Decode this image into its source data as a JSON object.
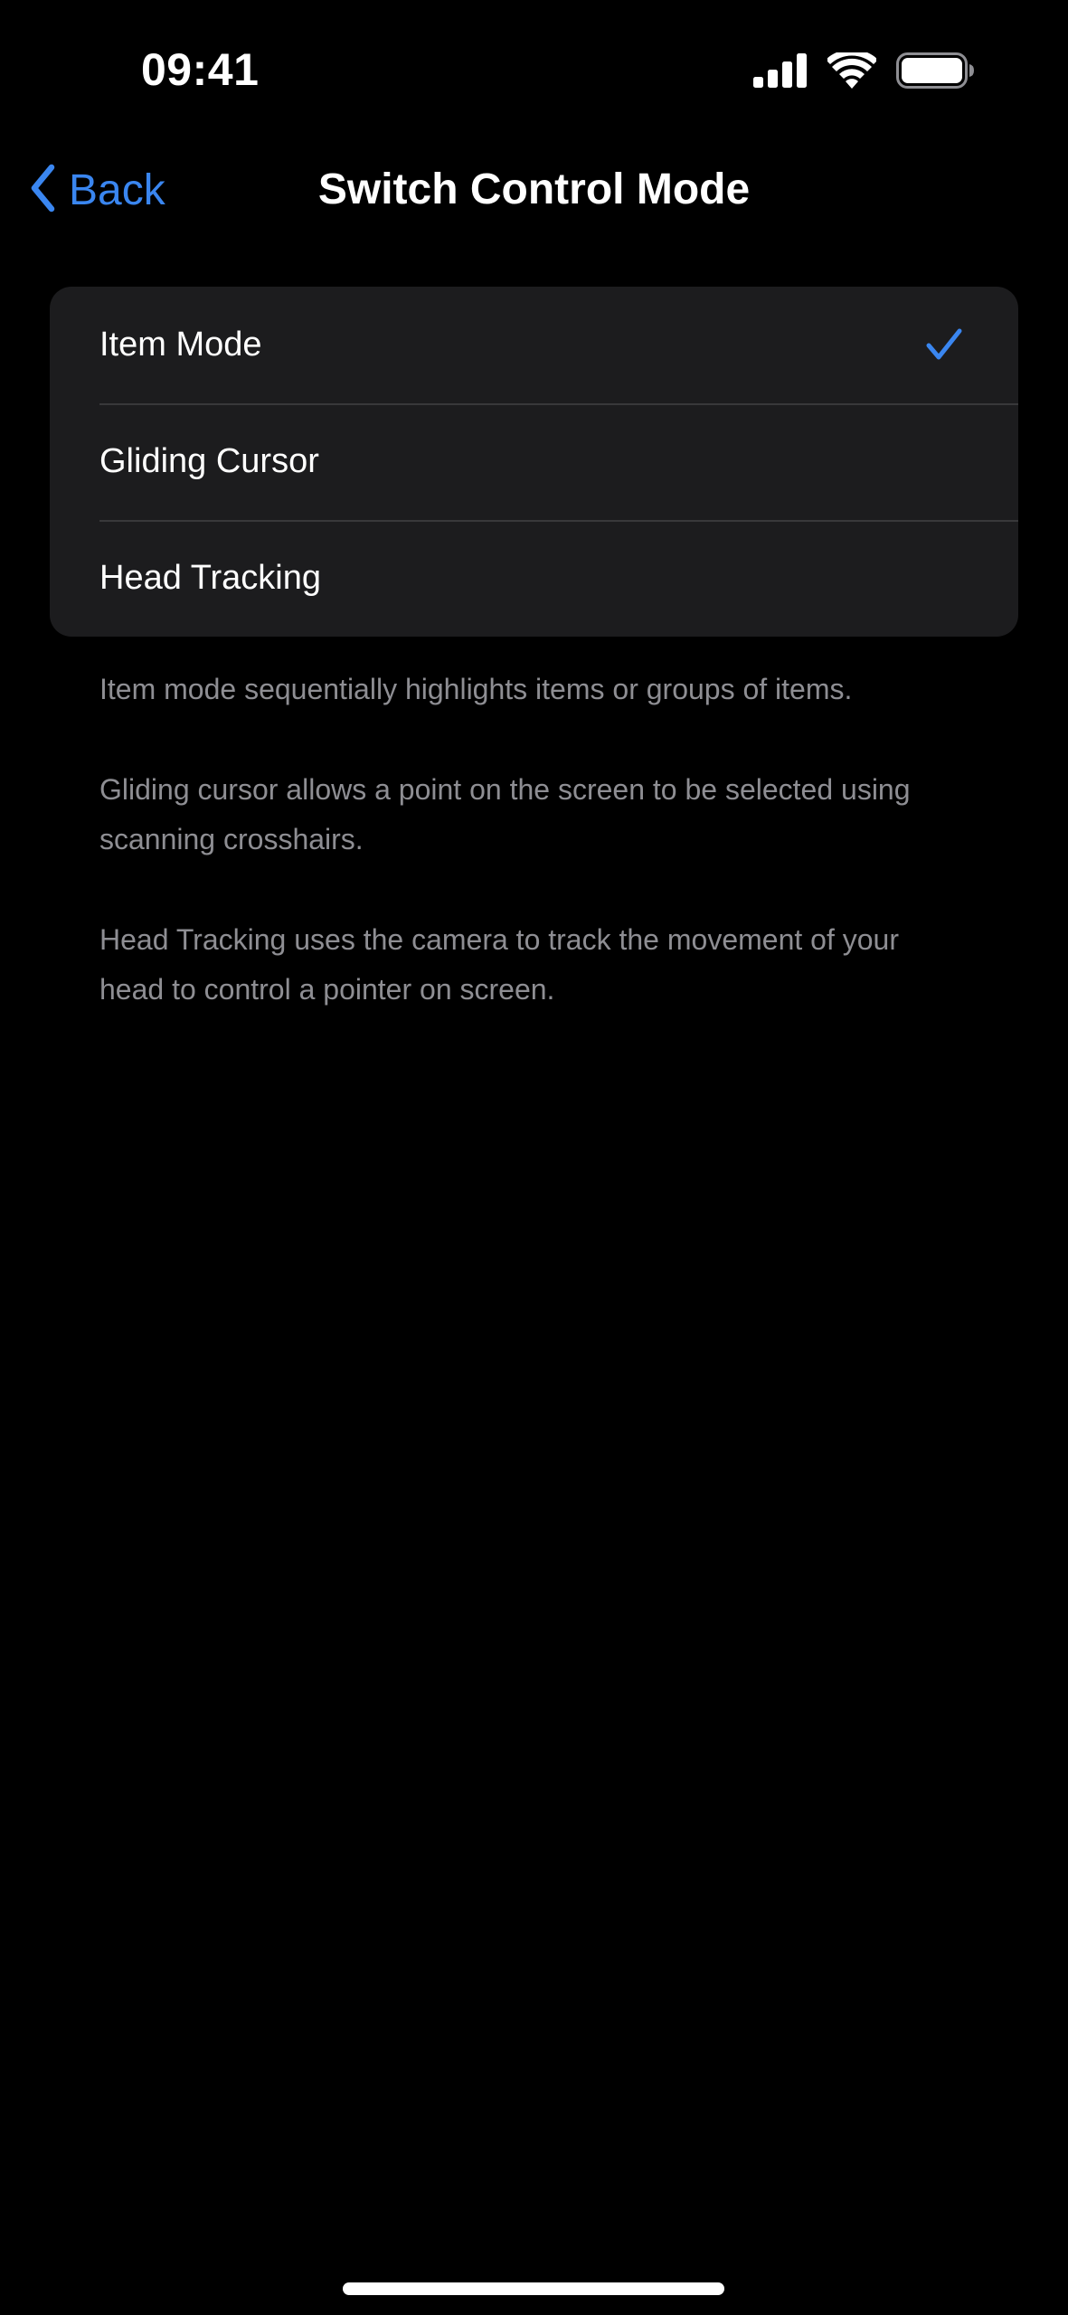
{
  "status_bar": {
    "time": "09:41",
    "icons": [
      "cellular-signal-icon",
      "wifi-icon",
      "battery-icon"
    ]
  },
  "nav": {
    "back_label": "Back",
    "title": "Switch Control Mode"
  },
  "options": [
    {
      "label": "Item Mode",
      "selected": true
    },
    {
      "label": "Gliding Cursor",
      "selected": false
    },
    {
      "label": "Head Tracking",
      "selected": false
    }
  ],
  "descriptions": [
    "Item mode sequentially highlights items or groups of items.",
    "Gliding cursor allows a point on the screen to be selected using scanning crosshairs.",
    "Head Tracking uses the camera to track the movement of your head to control a pointer on screen."
  ],
  "colors": {
    "background": "#000000",
    "group_background": "#1c1c1e",
    "accent": "#3a86f0",
    "secondary_text": "#8e8e93",
    "separator": "#38383a"
  }
}
